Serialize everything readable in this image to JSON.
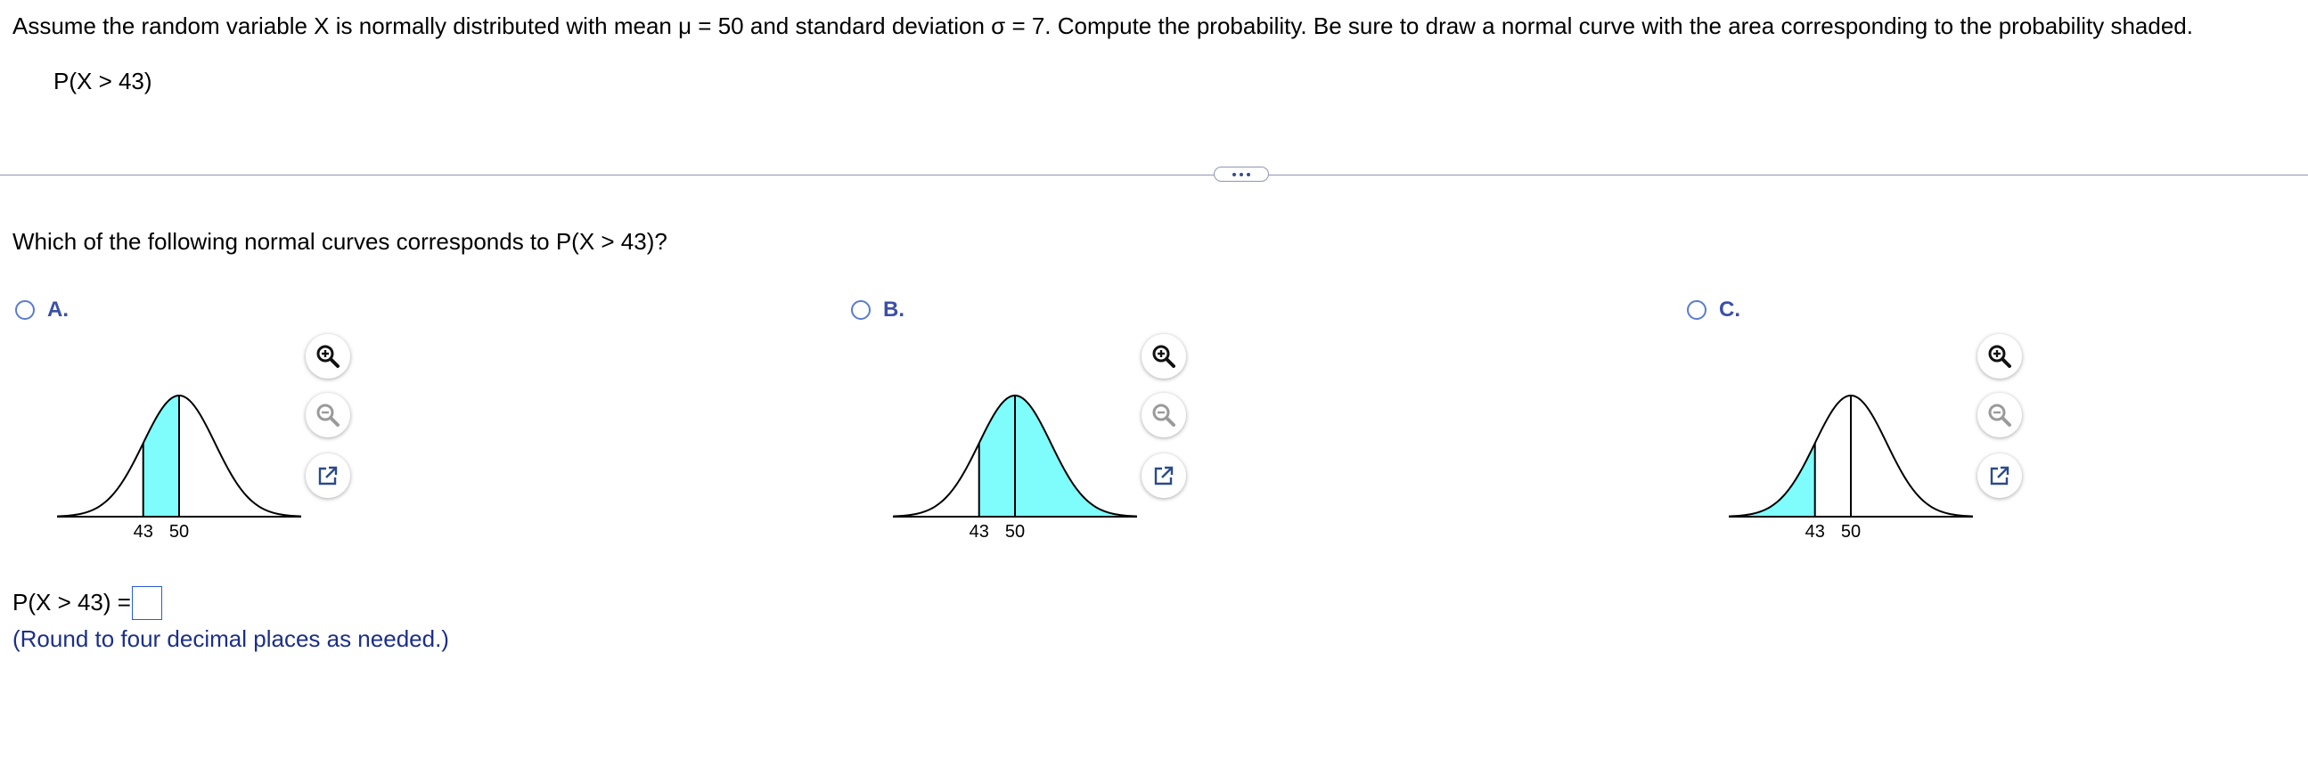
{
  "question": {
    "text": "Assume the random variable X is normally distributed with mean μ = 50 and standard deviation σ = 7. Compute the probability. Be sure to draw a normal curve with the area corresponding to the probability shaded.",
    "expression": "P(X > 43)"
  },
  "subquestion": {
    "text": "Which of the following normal curves corresponds to P(X > 43)?"
  },
  "options": [
    {
      "label": "A.",
      "shading": "between 43 and 50",
      "tick_left": "43",
      "tick_right": "50"
    },
    {
      "label": "B.",
      "shading": "right of 43",
      "tick_left": "43",
      "tick_right": "50"
    },
    {
      "label": "C.",
      "shading": "left of 43",
      "tick_left": "43",
      "tick_right": "50"
    }
  ],
  "answer": {
    "label": "P(X > 43) =",
    "value": "",
    "note": "(Round to four decimal places as needed.)"
  },
  "icons": {
    "zoom_in": "zoom-in-icon",
    "zoom_out": "zoom-out-icon",
    "popout": "popout-icon"
  },
  "colors": {
    "shade": "#7ffcfc",
    "radio_border": "#5a7bd1",
    "option_label": "#3b4fa8",
    "note": "#1b2f8a",
    "divider": "#8d96b6",
    "answer_box": "#2a5bd7"
  }
}
